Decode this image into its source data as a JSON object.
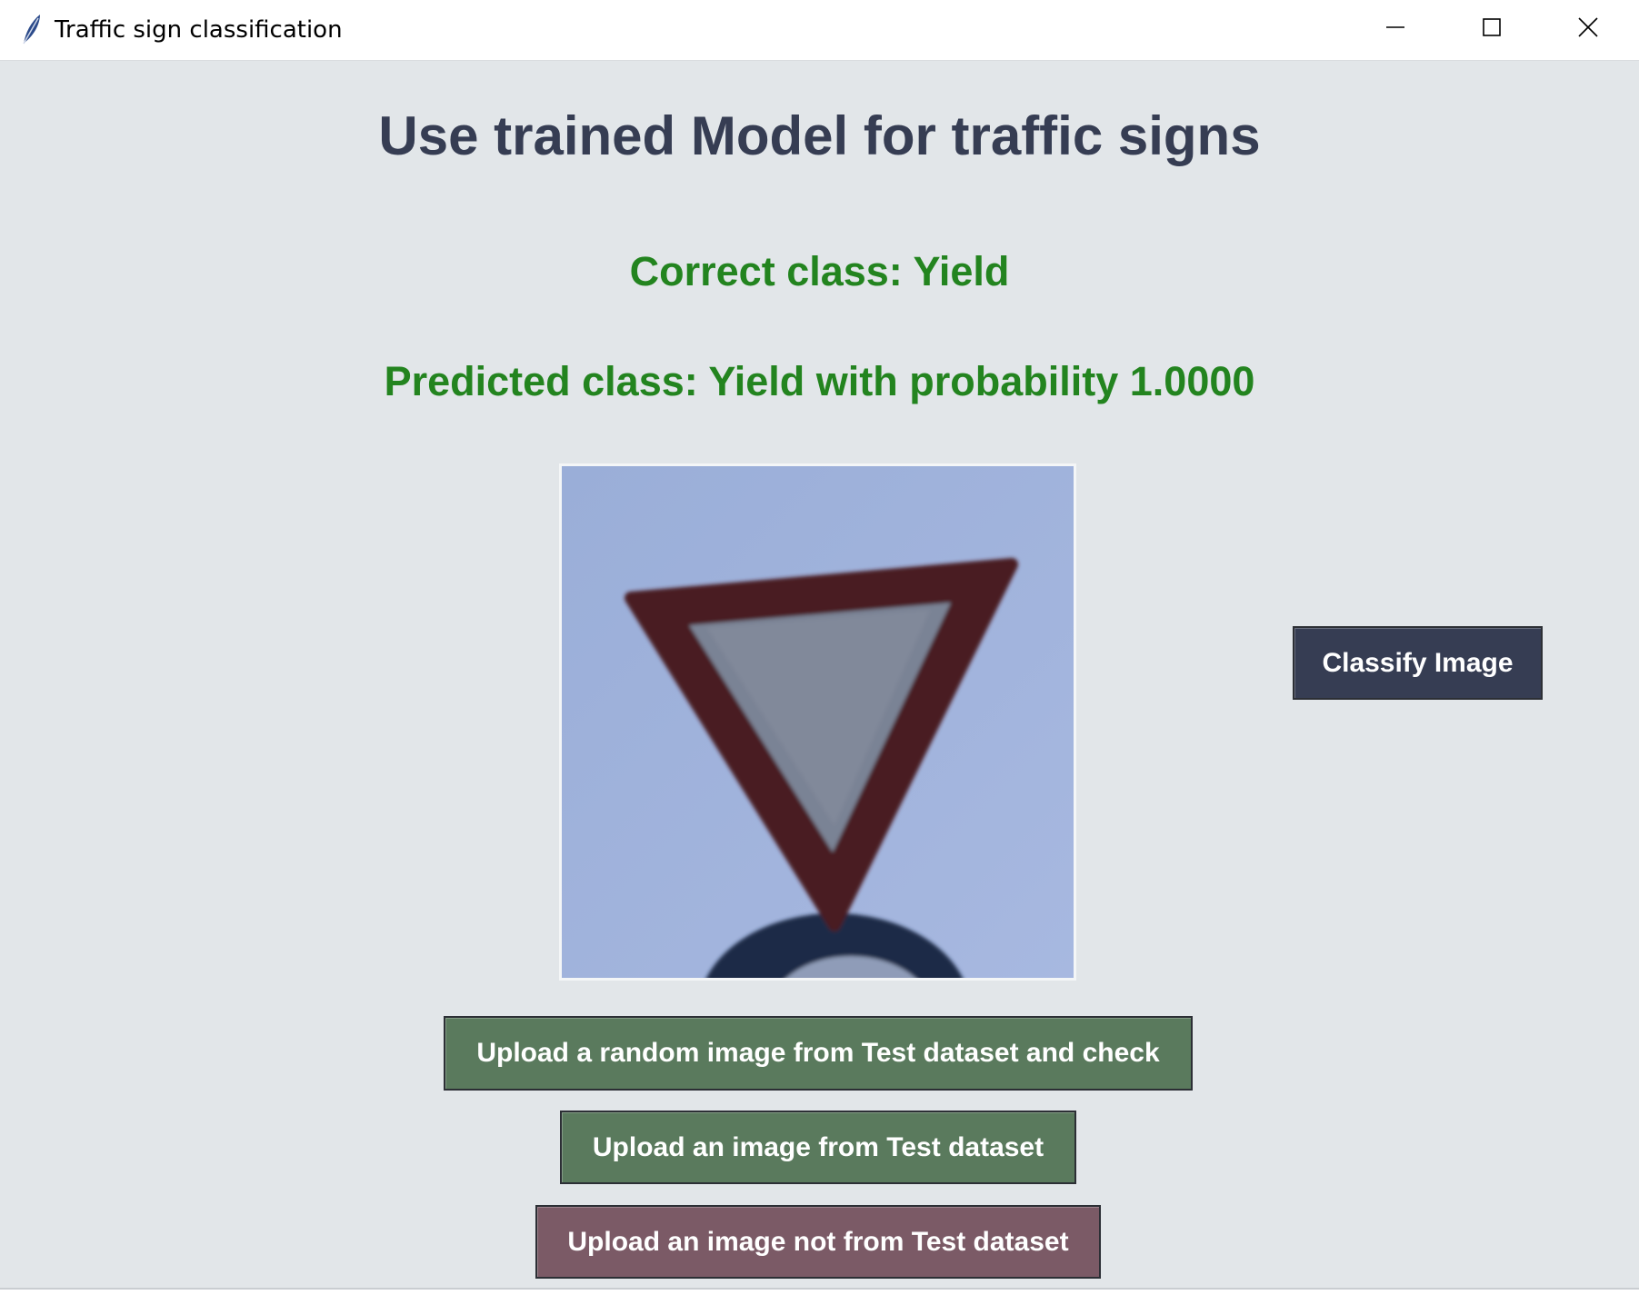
{
  "window": {
    "title": "Traffic sign classification",
    "icon": "feather-icon",
    "controls": [
      "minimize-icon",
      "maximize-icon",
      "close-icon"
    ]
  },
  "main": {
    "title": "Use trained Model for traffic signs",
    "correct_class": "Correct class: Yield",
    "predicted_class": "Predicted class: Yield with probability 1.0000",
    "image": "yield-sign-image"
  },
  "buttons": {
    "classify": "Classify Image",
    "upload_random": "Upload a random image from Test dataset and check",
    "upload_test": "Upload an image from Test dataset",
    "upload_other": "Upload an image not from Test dataset"
  },
  "colors": {
    "background": "#e2e6e9",
    "title_text": "#363d53",
    "result_text": "#23841f",
    "classify_button": "#363d53",
    "green_button": "#5a7a5d",
    "mauve_button": "#7b5a66"
  }
}
